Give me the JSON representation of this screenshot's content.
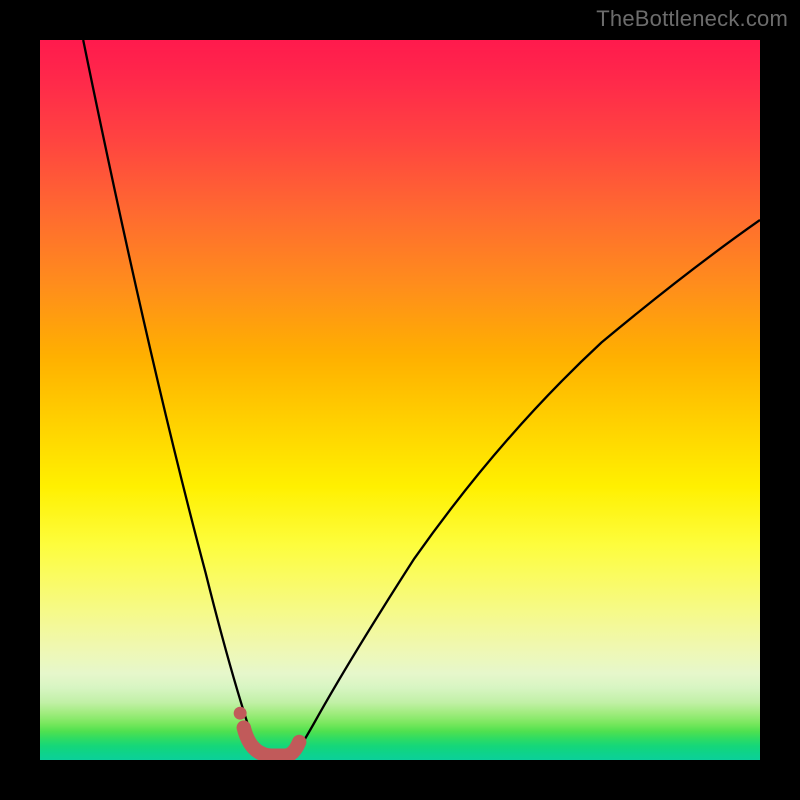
{
  "watermark": "TheBottleneck.com",
  "chart_data": {
    "type": "line",
    "title": "",
    "xlabel": "",
    "ylabel": "",
    "xlim": [
      0,
      100
    ],
    "ylim": [
      0,
      100
    ],
    "grid": false,
    "legend": false,
    "note": "Axes are unlabeled in the image; values are relative percentages of the plotting area (0 = bottom/left, 100 = top/right).",
    "series": [
      {
        "name": "left-curve",
        "x": [
          6,
          10,
          14,
          18,
          22,
          24,
          26,
          27.5,
          29,
          30
        ],
        "y": [
          100,
          82,
          63,
          44,
          26,
          17,
          9,
          5,
          2,
          0
        ]
      },
      {
        "name": "right-curve",
        "x": [
          34,
          36,
          38,
          41,
          45,
          50,
          56,
          63,
          71,
          80,
          90,
          100
        ],
        "y": [
          0,
          3,
          6,
          11,
          18,
          26,
          35,
          44,
          53,
          61,
          69,
          76
        ]
      },
      {
        "name": "valley-marker",
        "x": [
          28,
          29,
          30,
          31,
          32,
          33,
          34,
          35
        ],
        "y": [
          4,
          1.5,
          0.5,
          0.5,
          0.5,
          0.5,
          1,
          2
        ]
      }
    ],
    "gradient_stops_pct_from_top": {
      "red": 0,
      "orange": 34,
      "yellow": 62,
      "pale_yellow": 85,
      "green_transition": 92,
      "teal_green": 100
    }
  }
}
